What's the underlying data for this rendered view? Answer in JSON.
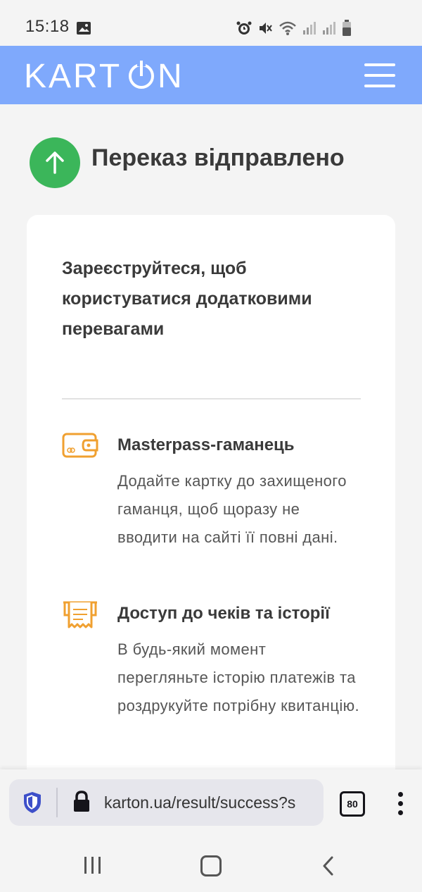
{
  "status": {
    "time": "15:18"
  },
  "header": {
    "logo": "KART⏽N"
  },
  "success": {
    "title": "Переказ відправлено"
  },
  "card": {
    "title": "Зареєструйтеся, щоб користуватися додатковими перевагами",
    "features": [
      {
        "icon": "wallet-icon",
        "title": "Masterpass-гаманець",
        "description": "Додайте картку до захищеного гаманця, щоб щоразу не вводити на сайті її повні дані."
      },
      {
        "icon": "receipt-icon",
        "title": "Доступ до чеків та історії",
        "description": "В будь-який момент перегляньте історію платежів та роздрукуйте потрібну квитанцію."
      }
    ]
  },
  "browser": {
    "url": "karton.ua/result/success?s",
    "tab_count": "80"
  },
  "colors": {
    "header": "#7fa9fc",
    "success": "#3bb65a",
    "accent_icon": "#f0a030"
  }
}
